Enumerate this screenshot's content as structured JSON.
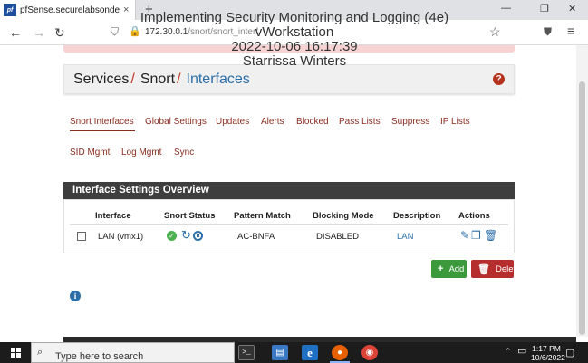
{
  "browser": {
    "tab_title": "pfSense.securelabsondemand.c",
    "tab_close": "×",
    "new_tab": "+",
    "url_host": "172.30.0.1",
    "url_path": "/snort/snort_interf",
    "window_controls": [
      "—",
      "❐",
      "✕"
    ]
  },
  "watermark": {
    "line1": "Implementing Security Monitoring and Logging (4e)",
    "line2": "vWorkstation",
    "line3": "2022-10-06 16:17:39",
    "line4": "Starrissa Winters"
  },
  "breadcrumb": {
    "items": [
      "Services",
      "Snort",
      "Interfaces"
    ],
    "separator": "/",
    "help_glyph": "?"
  },
  "tabs_row1": [
    "Snort Interfaces",
    "Global Settings",
    "Updates",
    "Alerts",
    "Blocked",
    "Pass Lists",
    "Suppress",
    "IP Lists"
  ],
  "tabs_row2": [
    "SID Mgmt",
    "Log Mgmt",
    "Sync"
  ],
  "active_tab": "Snort Interfaces",
  "panel": {
    "title": "Interface Settings Overview",
    "columns": [
      "Interface",
      "Snort Status",
      "Pattern Match",
      "Blocking Mode",
      "Description",
      "Actions"
    ],
    "rows": [
      {
        "interface": "LAN (vmx1)",
        "status_icons": [
          "check-circle-icon",
          "restart-icon",
          "stop-icon"
        ],
        "pattern_match": "AC-BNFA",
        "blocking_mode": "DISABLED",
        "description": "LAN",
        "actions": [
          "pencil-icon",
          "copy-icon",
          "trash-icon"
        ]
      }
    ]
  },
  "buttons": {
    "add_label": "Add",
    "add_glyph": "+",
    "delete_label": "Delete",
    "delete_glyph": "🗑"
  },
  "info_glyph": "i",
  "taskbar": {
    "search_placeholder": "Type here to search",
    "time": "1:17 PM",
    "date": "10/6/2022"
  },
  "colors": {
    "accent_red": "#8a2d1f",
    "link_blue": "#2c6fa8",
    "add_green": "#3c9a3c",
    "delete_red": "#b52d2d",
    "panel_header": "#3e3e3e"
  }
}
